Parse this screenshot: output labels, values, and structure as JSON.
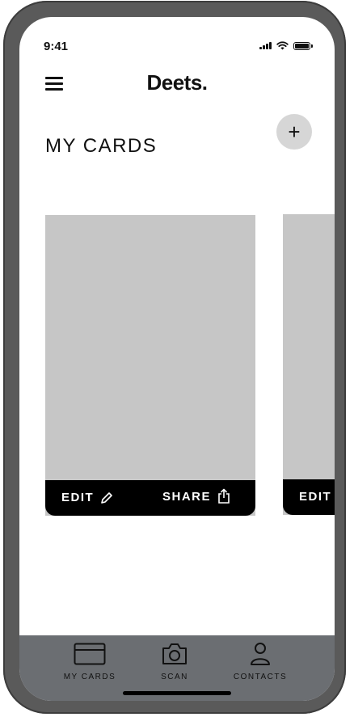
{
  "status_bar": {
    "time": "9:41"
  },
  "header": {
    "logo": "Deets.",
    "title": "MY CARDS",
    "add_label": "+"
  },
  "cards": [
    {
      "edit_label": "EDIT",
      "share_label": "SHARE"
    },
    {
      "edit_label": "EDIT"
    }
  ],
  "bottom_nav": {
    "items": [
      {
        "label": "MY CARDS",
        "icon": "card-icon"
      },
      {
        "label": "SCAN",
        "icon": "camera-icon"
      },
      {
        "label": "CONTACTS",
        "icon": "user-icon"
      }
    ]
  },
  "colors": {
    "card": "#c6c6c6",
    "nav": "#6b6e72",
    "add_button": "#d6d6d6"
  }
}
